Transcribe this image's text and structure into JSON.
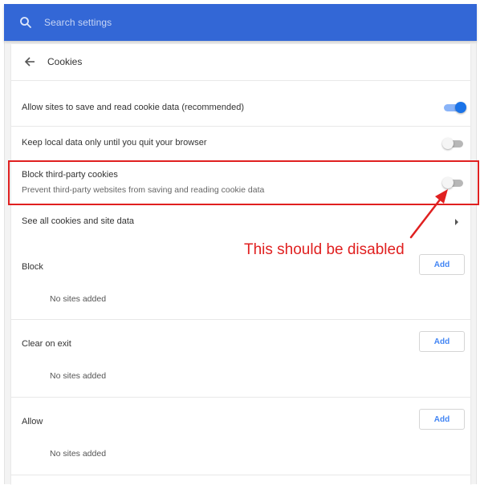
{
  "search": {
    "placeholder": "Search settings",
    "icon": "search-icon"
  },
  "page": {
    "title": "Cookies",
    "back_icon": "arrow-back-icon"
  },
  "settings": {
    "allow_sites": {
      "label": "Allow sites to save and read cookie data (recommended)",
      "enabled": true
    },
    "keep_local": {
      "label": "Keep local data only until you quit your browser",
      "enabled": false
    },
    "block_third_party": {
      "label": "Block third-party cookies",
      "description": "Prevent third-party websites from saving and reading cookie data",
      "enabled": false
    },
    "see_all": {
      "label": "See all cookies and site data",
      "icon": "chevron-right-icon"
    }
  },
  "sections": [
    {
      "label": "Block",
      "button": "Add",
      "empty": "No sites added"
    },
    {
      "label": "Clear on exit",
      "button": "Add",
      "empty": "No sites added"
    },
    {
      "label": "Allow",
      "button": "Add",
      "empty": "No sites added"
    }
  ],
  "annotation": {
    "text": "This should be disabled",
    "color": "#e02020"
  },
  "colors": {
    "header": "#3367d6",
    "accent": "#1a73e8",
    "button_text": "#4285f4"
  }
}
